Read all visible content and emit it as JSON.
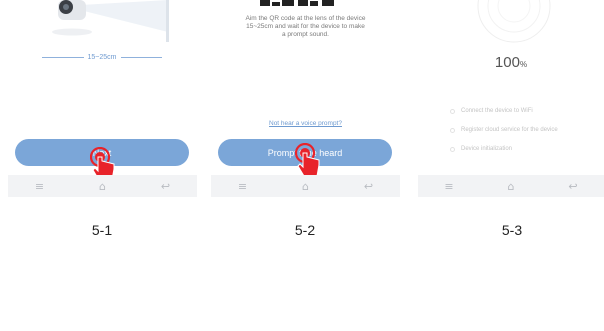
{
  "panels": [
    {
      "distance": "15~25cm",
      "button_label": "Next",
      "nav": [
        "menu-icon",
        "home-icon",
        "back-icon"
      ]
    },
    {
      "instructions": "Aim the QR code at the lens of the device\n15~25cm and wait for the device to make\na prompt sound.",
      "not_hear_link": "Not hear a voice prompt?",
      "button_label": "Prompt tone heard",
      "nav": [
        "menu-icon",
        "home-icon",
        "back-icon"
      ]
    },
    {
      "progress_value": "100",
      "progress_unit": "%",
      "progress": 1.0,
      "steps": [
        "Connect the device to WiFi",
        "Register cloud service for the device",
        "Device initialization"
      ],
      "nav": [
        "menu-icon",
        "home-icon",
        "back-icon"
      ]
    }
  ],
  "captions": [
    "5-1",
    "5-2",
    "5-3"
  ],
  "colors": {
    "accent": "#7ba6d8",
    "link": "#6e9ad0",
    "hand": "#e8232a",
    "navbar": "#f2f3f5"
  }
}
